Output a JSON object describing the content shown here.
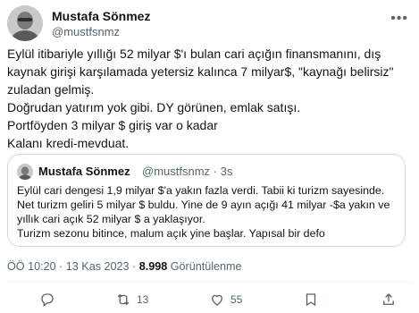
{
  "tweet": {
    "author_name": "Mustafa Sönmez",
    "author_handle": "@mustfsnmz",
    "more_icon": "more-icon",
    "lines": [
      "Eylül itibariyle yıllığı 52 milyar $'ı bulan cari açığın finansmanını, dış kaynak girişi karşılamada yetersiz kalınca 7 milyar$, \"kaynağı belirsiz\" zuladan gelmiş.",
      "Doğrudan yatırım yok gibi. DY görünen, emlak satışı.",
      "Portföyden 3 milyar $ giriş var o kadar",
      "Kalanı kredi-mevduat."
    ],
    "meta_time": "ÖÖ 10:20 · 13 Kas 2023 ·",
    "views_count": "8.998",
    "views_label": "Görüntülenme"
  },
  "quote": {
    "author_name": "Mustafa Sönmez",
    "author_handle": "@mustfsnmz · 3s",
    "lines": [
      "Eylül cari dengesi 1,9 milyar $'a yakın fazla verdi. Tabii ki turizm sayesinde. Net turizm geliri 5 milyar $ buldu. Yine de 9 ayın açığı 41 milyar -$a yakın ve yıllık cari açık 52 milyar $ a yaklaşıyor.",
      "Turizm sezonu bitince, malum açık yine başlar. Yapısal bir defo"
    ]
  },
  "actions": {
    "reply_count": "",
    "retweet_count": "13",
    "like_count": "55",
    "icons": [
      "reply-icon",
      "retweet-icon",
      "like-icon",
      "bookmark-icon",
      "share-icon"
    ]
  }
}
